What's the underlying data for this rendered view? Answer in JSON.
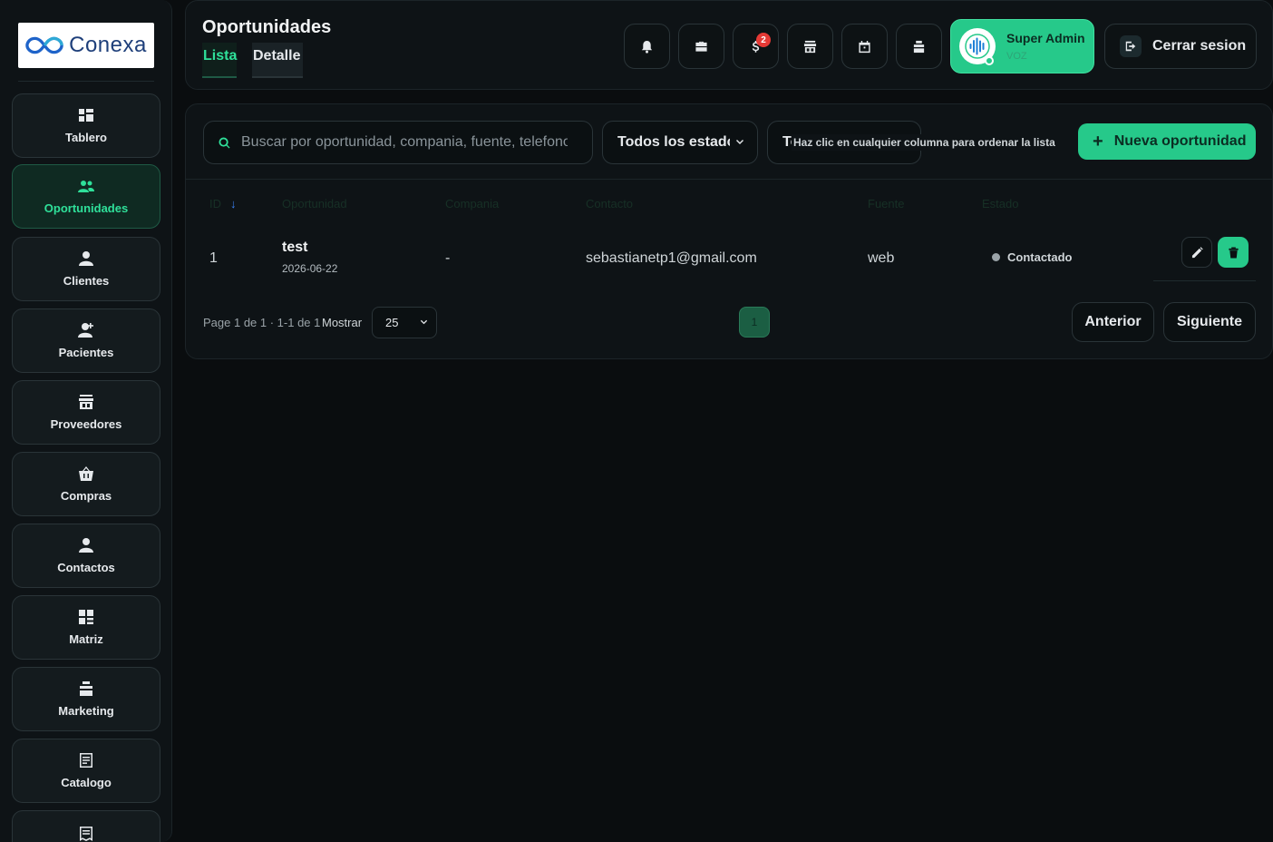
{
  "brand": {
    "name": "Conexa",
    "primary": "#26c98a",
    "accent": "#2fe09a",
    "logo_color": "#1e3f7a"
  },
  "sidebar": {
    "items": [
      {
        "label": "Tablero",
        "icon": "dashboard-icon"
      },
      {
        "label": "Oportunidades",
        "icon": "people-icon",
        "active": true
      },
      {
        "label": "Clientes",
        "icon": "person-icon"
      },
      {
        "label": "Pacientes",
        "icon": "person-add-icon"
      },
      {
        "label": "Proveedores",
        "icon": "store-icon"
      },
      {
        "label": "Compras",
        "icon": "shopping-basket-icon"
      },
      {
        "label": "Contactos",
        "icon": "person-icon"
      },
      {
        "label": "Matriz",
        "icon": "grid-icon"
      },
      {
        "label": "Marketing",
        "icon": "stack-icon"
      },
      {
        "label": "Catalogo",
        "icon": "list-icon"
      }
    ]
  },
  "header": {
    "title": "Oportunidades",
    "tabs": [
      {
        "label": "Lista",
        "active": true
      },
      {
        "label": "Detalle"
      }
    ],
    "icon_buttons": [
      {
        "icon": "bell-icon"
      },
      {
        "icon": "briefcase-icon"
      },
      {
        "icon": "dollar-icon",
        "badge": "2"
      },
      {
        "icon": "store-icon"
      },
      {
        "icon": "calendar-icon"
      },
      {
        "icon": "stack-icon"
      }
    ],
    "user": {
      "name": "Super Admin",
      "role": "VOZ",
      "status": "online"
    },
    "logout_label": "Cerrar sesion"
  },
  "toolbar": {
    "search_placeholder": "Buscar por oportunidad, compania, fuente, telefono",
    "status_filter": "Todos los estados",
    "sort_select_label": "Todas",
    "sort_tooltip": "Haz clic en cualquier columna para ordenar la lista",
    "new_button_label": "Nueva oportunidad"
  },
  "table": {
    "columns": [
      "ID",
      "Oportunidad",
      "Compania",
      "Contacto",
      "Fuente",
      "Estado"
    ],
    "sort_indicator": "↓",
    "rows": [
      {
        "id": "1",
        "name": "test",
        "date": "2026-06-22",
        "company": "-",
        "contact": "sebastianetp1@gmail.com",
        "source": "web",
        "status": "Contactado"
      }
    ]
  },
  "pagination": {
    "info": "Page 1 de 1 · 1-1 de 1",
    "show_label": "Mostrar",
    "page_size": "25",
    "current_page": "1",
    "prev_label": "Anterior",
    "next_label": "Siguiente"
  }
}
